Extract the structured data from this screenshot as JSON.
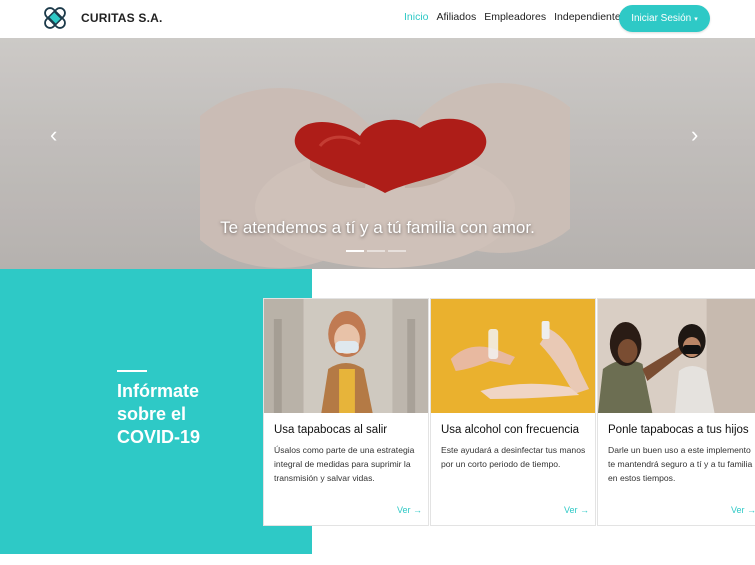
{
  "brand": {
    "name": "CURITAS S.A.",
    "logo_icon": "bandage-icon"
  },
  "nav": {
    "links": [
      "Inicio",
      "Afiliados",
      "Empleadores",
      "Independientes"
    ],
    "active": "Inicio",
    "login_label": "Iniciar Sesión",
    "login_caret": "▾"
  },
  "hero": {
    "caption": "Te atendemos a tí y a tú familia con amor.",
    "prev_icon": "‹",
    "next_icon": "›",
    "slides_count": 3,
    "active_slide": 1
  },
  "covid": {
    "title": "Infórmate sobre el COVID-19",
    "cards": [
      {
        "title": "Usa tapabocas al salir",
        "text": "Úsalos como parte de una estrategia integral de medidas para suprimir la transmisión y salvar vidas.",
        "link": "Ver →"
      },
      {
        "title": "Usa alcohol con frecuencia",
        "text": "Este ayudará a desinfectar tus manos por un corto periodo de tiempo.",
        "link": "Ver →"
      },
      {
        "title": "Ponle tapabocas a tus hijos",
        "text": "Darle un buen uso a este implemento te mantendrá seguro a tí y a tu familia en estos tiempos.",
        "link": "Ver →"
      }
    ]
  },
  "colors": {
    "accent": "#2ec9c6",
    "text": "#222222"
  }
}
